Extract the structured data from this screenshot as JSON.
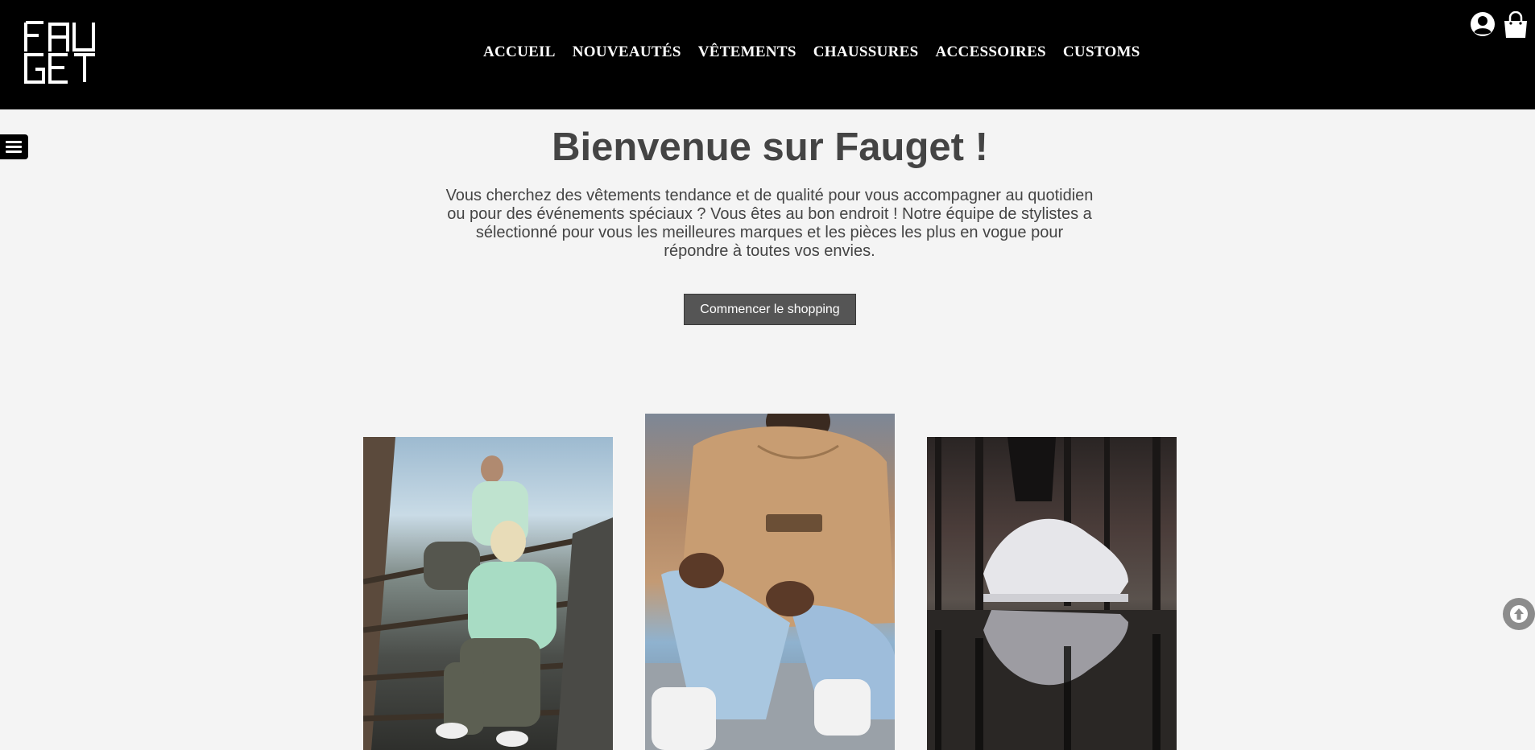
{
  "header": {
    "nav": [
      "ACCUEIL",
      "NOUVEAUTÉS",
      "VÊTEMENTS",
      "CHAUSSURES",
      "ACCESSOIRES",
      "CUSTOMS"
    ],
    "logo_text": "FAUGET"
  },
  "hero": {
    "title": "Bienvenue sur Fauget !",
    "text": "Vous cherchez des vêtements tendance et de qualité pour vous accompagner au quotidien ou pour des événements spéciaux ? Vous êtes au bon endroit ! Notre équipe de stylistes a sélectionné pour vous les meilleures marques et les pièces les plus en vogue pour répondre à toutes vos envies.",
    "cta_label": "Commencer le shopping"
  },
  "icons": {
    "user": "user-circle-icon",
    "cart": "shopping-bag-icon",
    "menu": "hamburger-menu-icon",
    "scroll_top": "arrow-up-circle-icon"
  },
  "colors": {
    "header_bg": "#000000",
    "page_bg": "#f4f4f4",
    "text": "#444444",
    "button_bg": "#555555"
  }
}
